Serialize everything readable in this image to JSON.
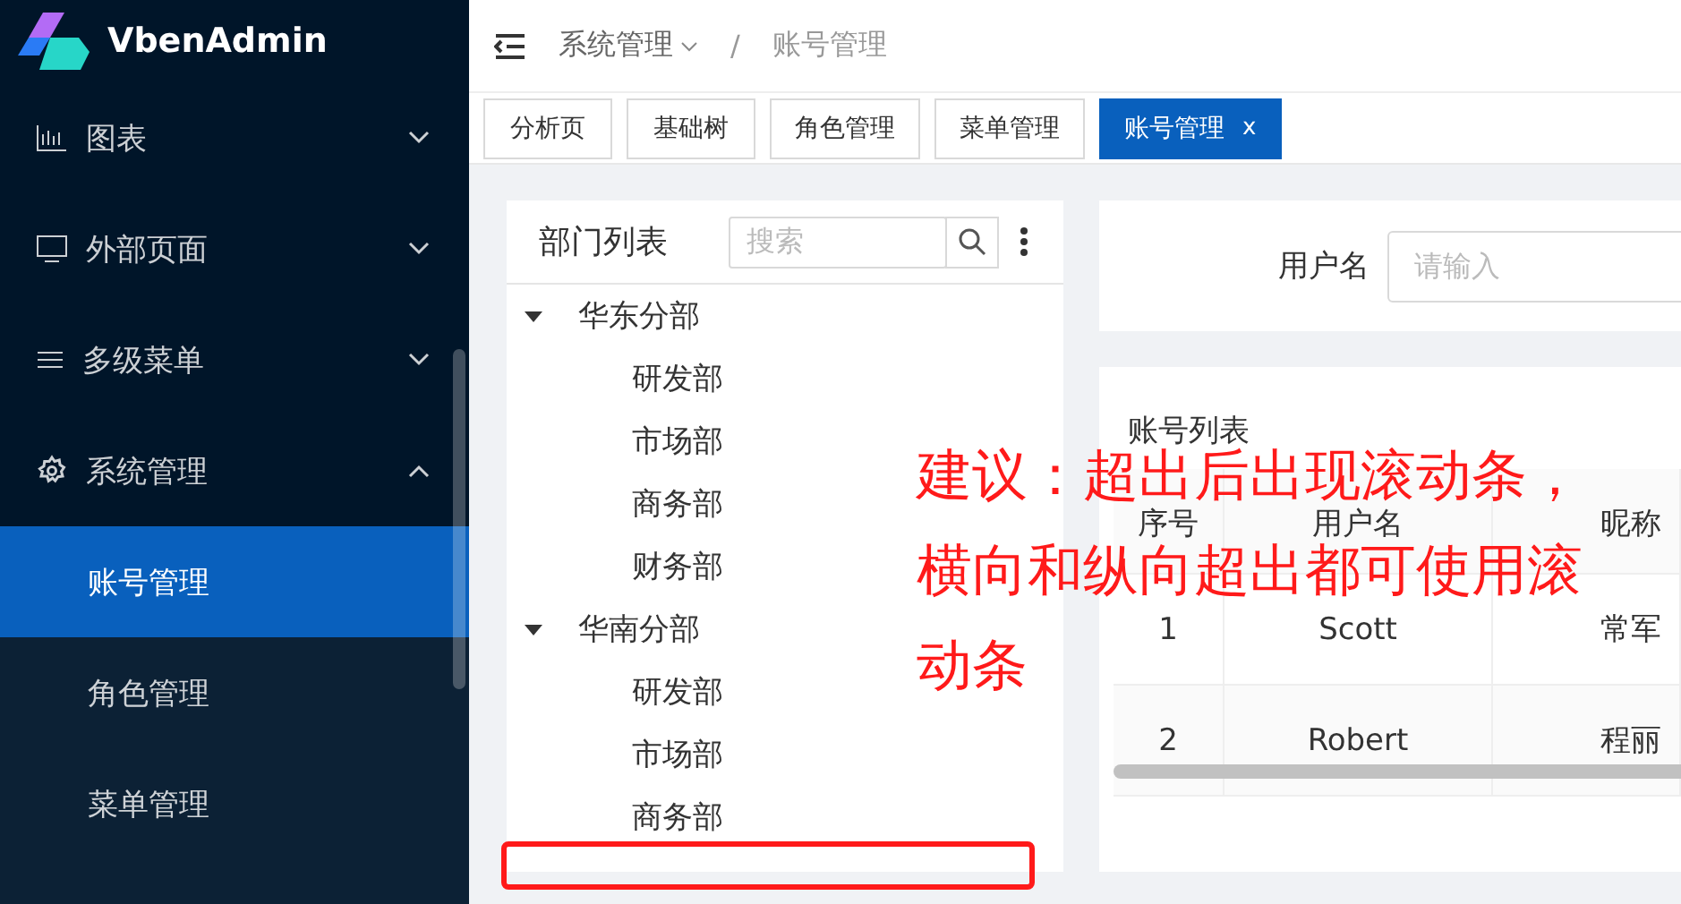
{
  "logo": {
    "title": "VbenAdmin"
  },
  "sidebar": {
    "items": [
      {
        "label": "图表",
        "expanded": false,
        "selected": false
      },
      {
        "label": "外部页面",
        "expanded": false,
        "selected": false
      },
      {
        "label": "多级菜单",
        "expanded": false,
        "selected": false
      },
      {
        "label": "系统管理",
        "expanded": true,
        "selected": false,
        "children": [
          {
            "label": "账号管理",
            "selected": true
          },
          {
            "label": "角色管理",
            "selected": false
          },
          {
            "label": "菜单管理",
            "selected": false
          }
        ]
      }
    ]
  },
  "breadcrumb": [
    {
      "label": "系统管理",
      "dropdown": true
    },
    {
      "separator": "/",
      "label": "账号管理",
      "dropdown": false
    }
  ],
  "tabs": [
    {
      "label": "分析页",
      "selected": false
    },
    {
      "label": "基础树",
      "selected": false
    },
    {
      "label": "角色管理",
      "selected": false
    },
    {
      "label": "菜单管理",
      "selected": false
    },
    {
      "label": "账号管理",
      "selected": true,
      "close": "x"
    }
  ],
  "dept_panel": {
    "title": "部门列表",
    "search": {
      "placeholder": "搜索"
    },
    "tree": [
      {
        "label": "华东分部",
        "expanded": true,
        "children": [
          {
            "label": "研发部"
          },
          {
            "label": "市场部"
          },
          {
            "label": "商务部"
          },
          {
            "label": "财务部"
          }
        ]
      },
      {
        "label": "华南分部",
        "expanded": true,
        "children": [
          {
            "label": "研发部"
          },
          {
            "label": "市场部"
          },
          {
            "label": "商务部"
          }
        ]
      }
    ]
  },
  "search_form": {
    "label": "用户名",
    "placeholder": "请输入"
  },
  "table": {
    "title": "账号列表",
    "columns": [
      "序号",
      "用户名",
      "昵称"
    ],
    "rows": [
      [
        "1",
        "Scott",
        "常军"
      ],
      [
        "2",
        "Robert",
        "程丽"
      ]
    ]
  },
  "annotation": {
    "lines": [
      "建议：超出后出现滚动条，",
      "横向和纵向超出都可使用滚",
      "动条"
    ]
  }
}
